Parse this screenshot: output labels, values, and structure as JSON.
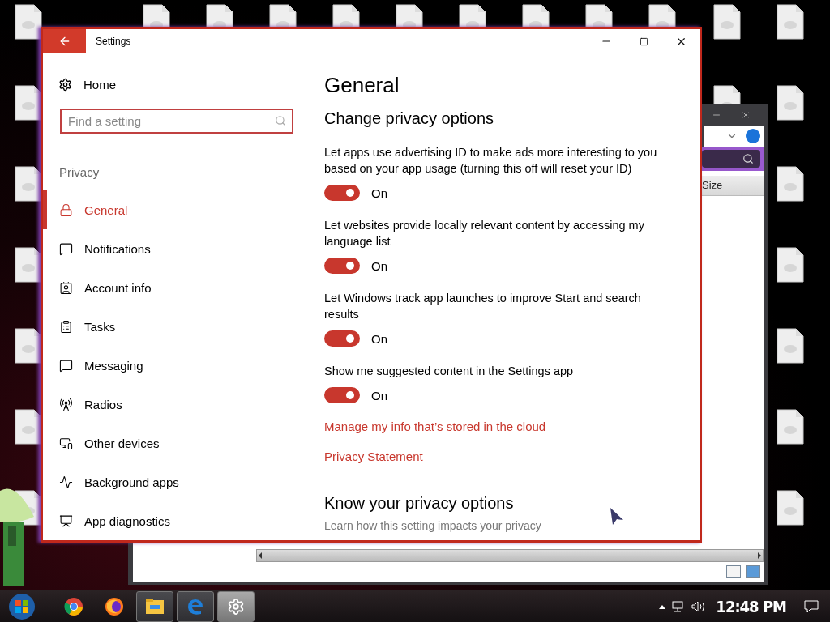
{
  "settings_window": {
    "title": "Settings",
    "home": "Home",
    "search": {
      "placeholder": "Find a setting"
    },
    "section": "Privacy",
    "nav": [
      {
        "label": "General",
        "kind": "lock",
        "selected": true
      },
      {
        "label": "Notifications",
        "kind": "bubble",
        "selected": false
      },
      {
        "label": "Account info",
        "kind": "contact",
        "selected": false
      },
      {
        "label": "Tasks",
        "kind": "clipboard",
        "selected": false
      },
      {
        "label": "Messaging",
        "kind": "bubble",
        "selected": false
      },
      {
        "label": "Radios",
        "kind": "antenna",
        "selected": false
      },
      {
        "label": "Other devices",
        "kind": "devices",
        "selected": false
      },
      {
        "label": "Background apps",
        "kind": "activity",
        "selected": false
      },
      {
        "label": "App diagnostics",
        "kind": "chart",
        "selected": false
      }
    ],
    "heading": "General",
    "subheading": "Change privacy options",
    "toggles": [
      {
        "description": "Let apps use advertising ID to make ads more interesting to you based on your app usage (turning this off will reset your ID)",
        "on": true,
        "state_label": "On"
      },
      {
        "description": "Let websites provide locally relevant content by accessing my language list",
        "on": true,
        "state_label": "On"
      },
      {
        "description": "Let Windows track app launches to improve Start and search results",
        "on": true,
        "state_label": "On"
      },
      {
        "description": "Show me suggested content in the Settings app",
        "on": true,
        "state_label": "On"
      }
    ],
    "links": [
      "Manage my info that’s stored in the cloud",
      "Privacy Statement"
    ],
    "section_heading": "Know your privacy options",
    "section_text": "Learn how this setting impacts your privacy"
  },
  "explorer_window": {
    "column": "Size"
  },
  "taskbar": {
    "apps": [
      {
        "kind": "chrome",
        "open": false,
        "selected": false
      },
      {
        "kind": "firefox",
        "open": false,
        "selected": false
      },
      {
        "kind": "explorer",
        "open": true,
        "selected": false
      },
      {
        "kind": "edge",
        "open": true,
        "selected": false
      },
      {
        "kind": "settings",
        "open": true,
        "selected": true
      }
    ],
    "clock": "12:48 PM"
  }
}
